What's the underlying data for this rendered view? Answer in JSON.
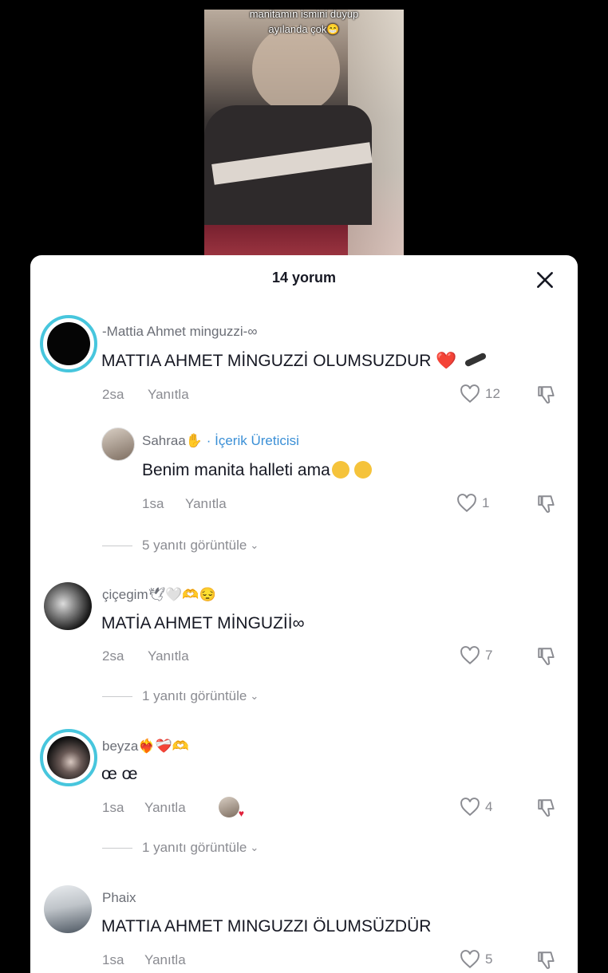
{
  "video": {
    "caption_line1": "manitamın ismini duyup",
    "caption_line2": "ayılanda çok😁"
  },
  "sheet": {
    "title": "14 yorum"
  },
  "comments": [
    {
      "user": "-Mattia Ahmet minguzzi-∞",
      "text": "MATTIA AHMET MİNGUZZİ OLUMSUZDUR",
      "text_suffix": "❤️",
      "time": "2sa",
      "reply": "Yanıtla",
      "likes": "12"
    },
    {
      "user": "Sahraa",
      "user_emoji": "✋",
      "badge": "· İçerik Üreticisi",
      "text": "Benim manita halleti ama",
      "time": "1sa",
      "reply": "Yanıtla",
      "likes": "1",
      "view": "5 yanıtı görüntüle"
    },
    {
      "user": "çiçegim",
      "user_emoji": "🕊🤍🫶😔",
      "text": "MATİA AHMET MİNGUZİİ∞",
      "time": "2sa",
      "reply": "Yanıtla",
      "likes": "7",
      "view": "1 yanıtı görüntüle"
    },
    {
      "user": "beyza",
      "user_emoji": "❤️‍🔥❤️‍🩹🫶",
      "text": "œ œ",
      "time": "1sa",
      "reply": "Yanıtla",
      "likes": "4",
      "view": "1 yanıtı görüntüle"
    },
    {
      "user": "Phaix",
      "text": "MATTIA AHMET MINGUZZI ÖLUMSÜZDÜR",
      "time": "1sa",
      "reply": "Yanıtla",
      "likes": "5"
    }
  ],
  "colors": {
    "accent": "#3a8fd6",
    "heart": "#e1213b",
    "text": "#161823",
    "muted": "#8a8b91"
  }
}
